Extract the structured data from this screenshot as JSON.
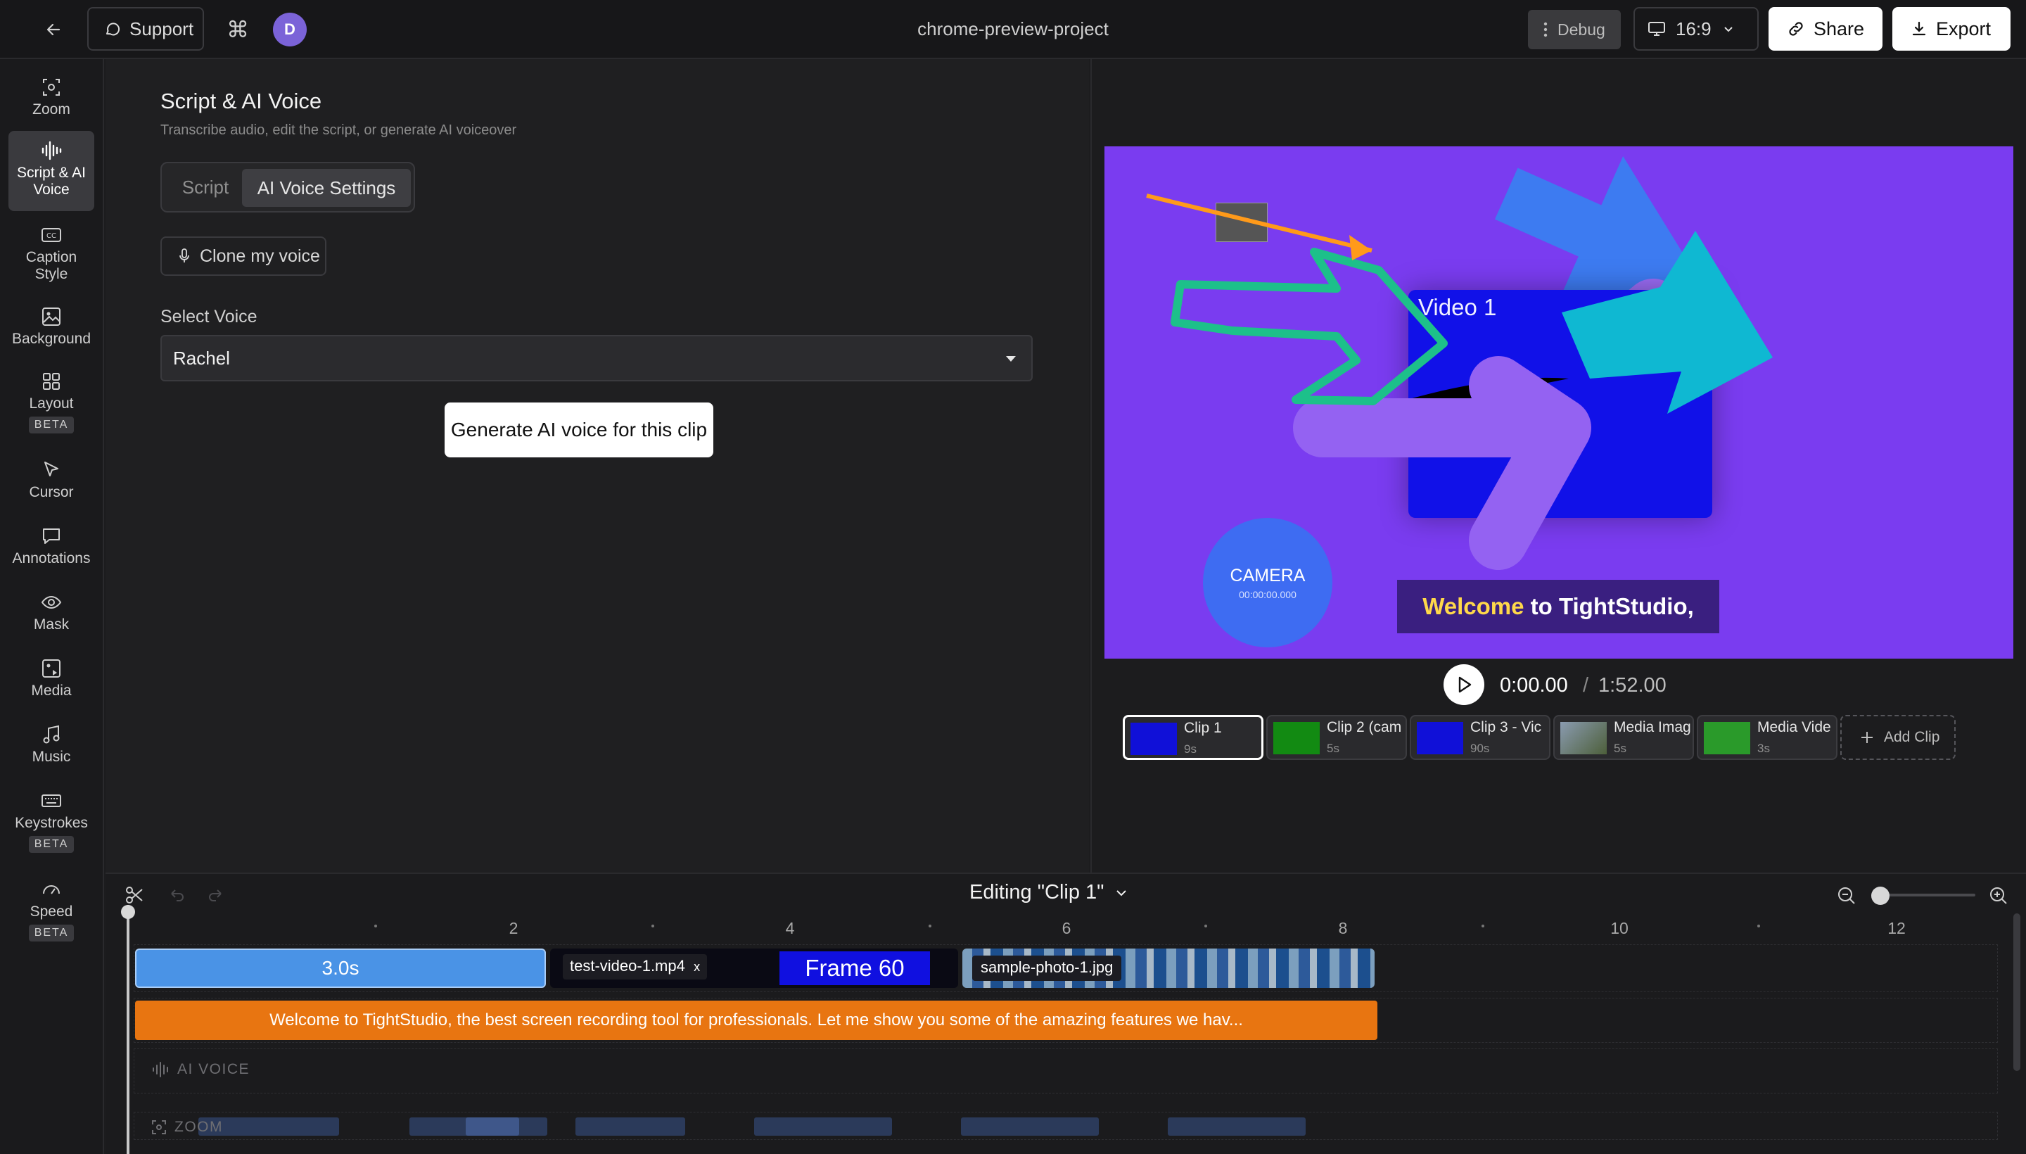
{
  "topbar": {
    "support_label": "Support",
    "cmd_glyph": "⌘",
    "avatar_initial": "D",
    "project_title": "chrome-preview-project",
    "debug_label": "Debug",
    "aspect_ratio": "16:9",
    "share_label": "Share",
    "export_label": "Export"
  },
  "rail": {
    "items": [
      {
        "label": "Zoom",
        "icon": "zoom-icon"
      },
      {
        "label": "Script & AI Voice",
        "icon": "waveform-icon",
        "active": true
      },
      {
        "label": "Caption Style",
        "icon": "cc-icon"
      },
      {
        "label": "Background",
        "icon": "image-icon"
      },
      {
        "label": "Layout",
        "icon": "grid-icon",
        "badge": "BETA"
      },
      {
        "label": "Cursor",
        "icon": "cursor-icon"
      },
      {
        "label": "Annotations",
        "icon": "comment-icon"
      },
      {
        "label": "Mask",
        "icon": "eye-icon"
      },
      {
        "label": "Media",
        "icon": "media-icon"
      },
      {
        "label": "Music",
        "icon": "music-icon"
      },
      {
        "label": "Keystrokes",
        "icon": "keyboard-icon",
        "badge": "BETA"
      },
      {
        "label": "Speed",
        "icon": "gauge-icon",
        "badge": "BETA"
      }
    ]
  },
  "panel": {
    "title": "Script & AI Voice",
    "subtitle": "Transcribe audio, edit the script, or generate AI voiceover",
    "tab_script": "Script",
    "tab_voice": "AI Voice Settings",
    "clone_label": "Clone my voice",
    "select_label": "Select Voice",
    "selected_voice": "Rachel",
    "generate_label": "Generate AI voice for this clip"
  },
  "preview": {
    "video_label": "Video 1",
    "camera_label": "CAMERA",
    "camera_time": "00:00:00.000",
    "caption_highlight": "Welcome",
    "caption_rest": " to TightStudio,",
    "time_current": "0:00.00",
    "time_sep": "/",
    "time_total": "1:52.00",
    "clips": [
      {
        "name": "Clip 1",
        "duration": "9s",
        "thumb": "#1010d8",
        "selected": true
      },
      {
        "name": "Clip 2 (cam",
        "duration": "5s",
        "thumb": "#128a12"
      },
      {
        "name": "Clip 3 - Vic",
        "duration": "90s",
        "thumb": "#1010d8"
      },
      {
        "name": "Media Imag",
        "duration": "5s",
        "thumb": "#6f8aa3"
      },
      {
        "name": "Media Vide",
        "duration": "3s",
        "thumb": "#2a9a2a"
      }
    ],
    "add_clip_label": "Add Clip"
  },
  "timeline": {
    "editing_label": "Editing \"Clip 1\"",
    "ticks": [
      "2",
      "4",
      "6",
      "8",
      "10",
      "12"
    ],
    "seg1_label": "3.0s",
    "seg2_label": "test-video-1.mp4",
    "seg2_close": "x",
    "seg2_frame": "Frame 60",
    "seg3_label": "sample-photo-1.jpg",
    "caption_text": "Welcome to TightStudio, the best screen recording tool for professionals. Let me show you some of the amazing features we hav...",
    "ai_voice_label": "AI VOICE",
    "zoom_label": "ZOOM"
  }
}
